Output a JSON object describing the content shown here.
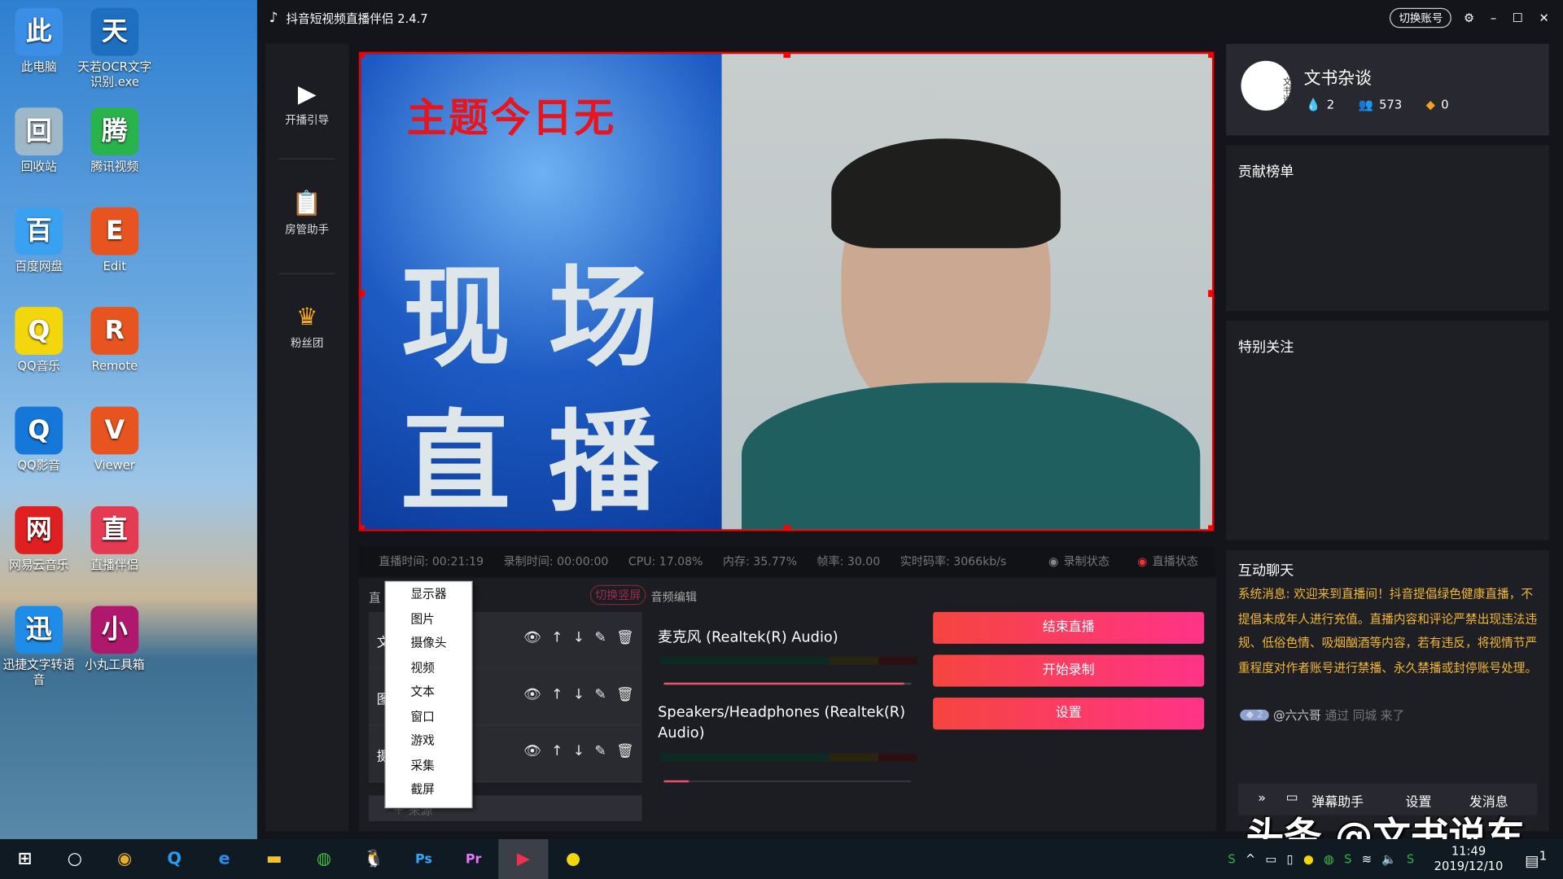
{
  "desktop": {
    "icons": [
      {
        "label": "此电脑",
        "icon": "computer-icon",
        "color": "#3a8ee6"
      },
      {
        "label": "天若OCR文字识别.exe",
        "icon": "ocr-app-icon",
        "color": "#1f6fc0"
      },
      {
        "label": "回收站",
        "icon": "recycle-bin-icon",
        "color": "#9fb8c8"
      },
      {
        "label": "腾讯视频",
        "icon": "tencent-video-icon",
        "color": "#28b34b"
      },
      {
        "label": "百度网盘",
        "icon": "baidu-netdisk-icon",
        "color": "#3aa0f0"
      },
      {
        "label": "Edit",
        "icon": "edit-app-icon",
        "color": "#e8541f"
      },
      {
        "label": "QQ音乐",
        "icon": "qq-music-icon",
        "color": "#f4d60c"
      },
      {
        "label": "Remote",
        "icon": "remote-app-icon",
        "color": "#e8541f"
      },
      {
        "label": "QQ影音",
        "icon": "qq-player-icon",
        "color": "#1577d8"
      },
      {
        "label": "Viewer",
        "icon": "viewer-app-icon",
        "color": "#e8541f"
      },
      {
        "label": "网易云音乐",
        "icon": "netease-music-icon",
        "color": "#e02020"
      },
      {
        "label": "直播伴侣",
        "icon": "live-companion-icon",
        "color": "#e53b52"
      },
      {
        "label": "迅捷文字转语音",
        "icon": "text-to-speech-icon",
        "color": "#1f8ce8"
      },
      {
        "label": "小丸工具箱",
        "icon": "toolbox-icon",
        "color": "#b0186e"
      }
    ]
  },
  "app": {
    "title": "抖音短视频直播伴侣 2.4.7",
    "switch_account": "切换账号",
    "nav": [
      {
        "label": "开播引导",
        "icon": "video-icon"
      },
      {
        "label": "房管助手",
        "icon": "clipboard-user-icon"
      },
      {
        "label": "粉丝团",
        "icon": "fan-club-icon"
      }
    ],
    "preview": {
      "poster_top": "主题今日无",
      "poster_line1": "现 场",
      "poster_line2": "直 播"
    },
    "stats": {
      "live_time": "直播时间: 00:21:19",
      "record_time": "录制时间: 00:00:00",
      "cpu": "CPU: 17.08%",
      "memory": "内存: 35.77%",
      "fps": "帧率: 30.00",
      "bitrate": "实时码率: 3066kb/s",
      "record_status": "录制状态",
      "live_status": "直播状态"
    },
    "scene_tab": "直",
    "switch_portrait": "切换竖屏",
    "audio_edit": "音频编辑",
    "sources": [
      {
        "label": "文"
      },
      {
        "label": "图"
      },
      {
        "label": "摄"
      }
    ],
    "add_source": "来源",
    "add_menu": [
      "显示器",
      "图片",
      "摄像头",
      "视频",
      "文本",
      "窗口",
      "游戏",
      "采集",
      "截屏"
    ],
    "audio": {
      "mic": "麦克风 (Realtek(R) Audio)",
      "mic_volume": 0.97,
      "speaker": "Speakers/Headphones (Realtek(R) Audio)",
      "speaker_volume": 0.1
    },
    "buttons": {
      "end_live": "结束直播",
      "start_record": "开始录制",
      "settings": "设置"
    },
    "profile": {
      "name": "文书杂谈",
      "avatar_text": "文书说",
      "likes": "2",
      "fans": "573",
      "diamonds": "0"
    },
    "contrib_title": "贡献榜单",
    "follow_title": "特别关注",
    "chat": {
      "title": "互动聊天",
      "system": "系统消息: 欢迎来到直播间！抖音提倡绿色健康直播，不提倡未成年人进行充值。直播内容和评论严禁出现违法违规、低俗色情、吸烟酗酒等内容，若有违反，将视情节严重程度对作者账号进行禁播、永久禁播或封停账号处理。",
      "badge_level": "2",
      "user": "@六六哥",
      "action": "通过 同城 来了",
      "danmu": "弹幕助手",
      "settings": "设置",
      "send": "发消息"
    }
  },
  "watermark": "头条 @文书说车",
  "taskbar": {
    "time": "11:49",
    "date": "2019/12/10",
    "notifications": "1"
  }
}
